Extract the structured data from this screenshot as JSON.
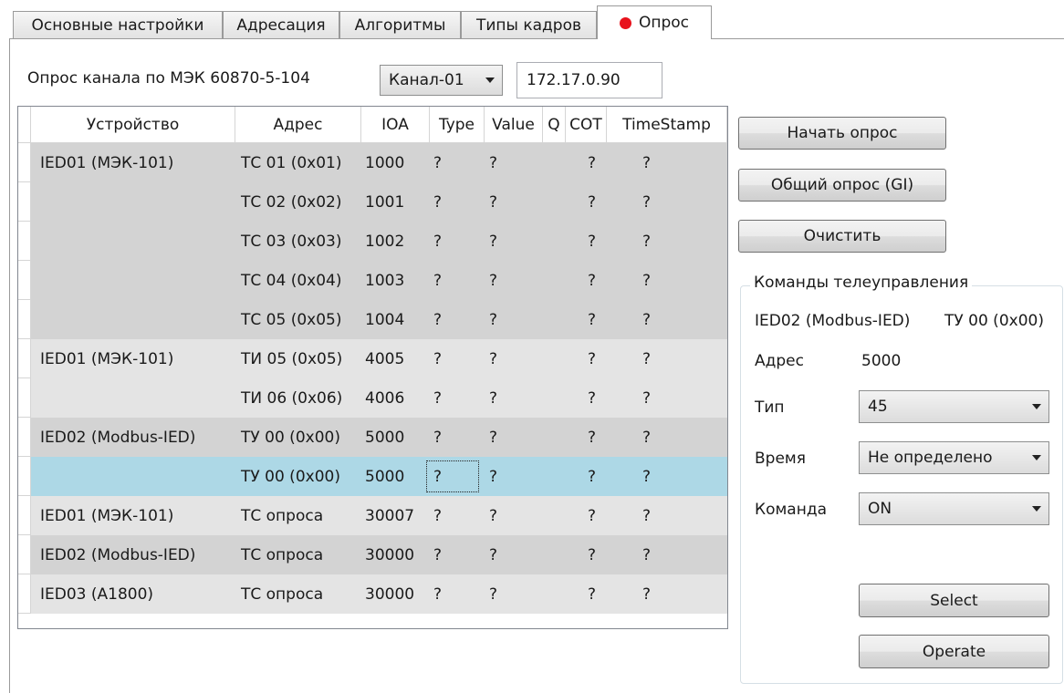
{
  "tabs": [
    {
      "label": "Основные настройки"
    },
    {
      "label": "Адресация"
    },
    {
      "label": "Алгоритмы"
    },
    {
      "label": "Типы кадров"
    },
    {
      "label": "Опрос"
    }
  ],
  "poll": {
    "label": "Опрос канала по МЭК 60870-5-104",
    "channel_value": "Канал-01",
    "ip_value": "172.17.0.90"
  },
  "table": {
    "columns": [
      "Устройство",
      "Адрес",
      "IOA",
      "Type",
      "Value",
      "Q",
      "COT",
      "TimeStamp"
    ],
    "rows": [
      [
        "IED01 (МЭК-101)",
        "ТС 01 (0x01)",
        "1000",
        "?",
        "?",
        "",
        "?",
        "?"
      ],
      [
        "",
        "ТС 02 (0x02)",
        "1001",
        "?",
        "?",
        "",
        "?",
        "?"
      ],
      [
        "",
        "ТС 03 (0x03)",
        "1002",
        "?",
        "?",
        "",
        "?",
        "?"
      ],
      [
        "",
        "ТС 04 (0x04)",
        "1003",
        "?",
        "?",
        "",
        "?",
        "?"
      ],
      [
        "",
        "ТС 05 (0x05)",
        "1004",
        "?",
        "?",
        "",
        "?",
        "?"
      ],
      [
        "IED01 (МЭК-101)",
        "ТИ 05 (0x05)",
        "4005",
        "?",
        "?",
        "",
        "?",
        "?"
      ],
      [
        "",
        "ТИ 06 (0x06)",
        "4006",
        "?",
        "?",
        "",
        "?",
        "?"
      ],
      [
        "IED02 (Modbus-IED)",
        "ТУ 00 (0x00)",
        "5000",
        "?",
        "?",
        "",
        "?",
        "?"
      ],
      [
        "",
        "ТУ 00 (0x00)",
        "5000",
        "?",
        "?",
        "",
        "?",
        "?"
      ],
      [
        "IED01 (МЭК-101)",
        "ТС опроса",
        "30007",
        "?",
        "?",
        "",
        "?",
        "?"
      ],
      [
        "IED02 (Modbus-IED)",
        "ТС опроса",
        "30000",
        "?",
        "?",
        "",
        "?",
        "?"
      ],
      [
        "IED03 (A1800)",
        "ТС опроса",
        "30000",
        "?",
        "?",
        "",
        "?",
        "?"
      ]
    ]
  },
  "buttons": {
    "start": "Начать опрос",
    "gi": "Общий опрос (GI)",
    "clear": "Очистить",
    "select": "Select",
    "operate": "Operate"
  },
  "commands": {
    "title": "Команды телеуправления",
    "device": "IED02 (Modbus-IED)",
    "point": "ТУ 00 (0x00)",
    "address_label": "Адрес",
    "address_value": "5000",
    "type_label": "Тип",
    "type_value": "45",
    "time_label": "Время",
    "time_value": "Не определено",
    "command_label": "Команда",
    "command_value": "ON"
  },
  "colors": {
    "group_dark": "#d3d3d3",
    "group_light": "#e4e4e4",
    "selected_row": "#add8e6",
    "status_dot": "#e8121c"
  }
}
